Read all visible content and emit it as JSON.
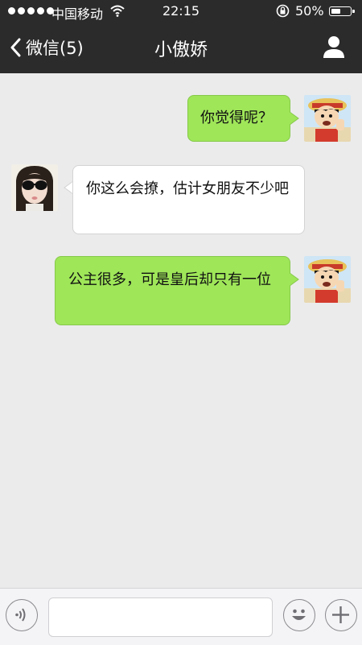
{
  "status_bar": {
    "carrier": "中国移动",
    "time": "22:15",
    "battery": "50%",
    "battery_level": 0.5,
    "icons": [
      "signal-dots",
      "wifi-icon",
      "rotation-lock-icon",
      "battery-icon"
    ]
  },
  "nav": {
    "back_label": "微信(5)",
    "title": "小傲娇",
    "icons": [
      "chevron-left-icon",
      "person-icon"
    ]
  },
  "messages": [
    {
      "direction": "out",
      "text": "你觉得呢？",
      "avatar": "cartoon-pirate-avatar"
    },
    {
      "direction": "in",
      "text": "你这么会撩，估计女朋友不少吧",
      "avatar": "sunglasses-girl-avatar"
    },
    {
      "direction": "out",
      "text": "公主很多，可是皇后却只有一位",
      "avatar": "cartoon-pirate-avatar"
    }
  ],
  "input_bar": {
    "icons": [
      "voice-icon",
      "emoji-icon",
      "plus-icon"
    ],
    "text_value": ""
  },
  "colors": {
    "header_bg": "#2b2b2b",
    "chat_bg": "#ebebeb",
    "outgoing_bubble": "#9fe659",
    "incoming_bubble": "#ffffff",
    "input_bar_bg": "#f4f4f6"
  }
}
